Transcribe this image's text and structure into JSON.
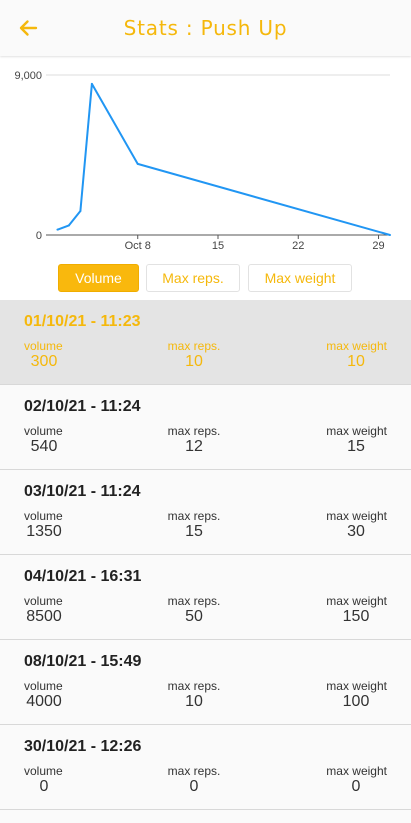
{
  "appbar": {
    "title": "Stats : Push Up",
    "back_icon": "arrow-left-icon",
    "accent_color": "#f5b80c"
  },
  "chart_data": {
    "type": "line",
    "x": [
      "2021-10-01",
      "2021-10-02",
      "2021-10-03",
      "2021-10-04",
      "2021-10-08",
      "2021-10-30"
    ],
    "values": [
      300,
      540,
      1350,
      8500,
      4000,
      0
    ],
    "y_tick_labels": [
      "9,000",
      "0"
    ],
    "y_ticks": [
      9000,
      0
    ],
    "ylim": [
      0,
      9000
    ],
    "x_tick_labels": [
      "Oct 8",
      "15",
      "22",
      "29"
    ],
    "x_ticks": [
      "2021-10-08",
      "2021-10-15",
      "2021-10-22",
      "2021-10-29"
    ],
    "xlim": [
      "2021-09-30",
      "2021-10-30"
    ],
    "line_color": "#2196f3",
    "grid": "horizontal"
  },
  "toggles": [
    {
      "label": "Volume",
      "active": true
    },
    {
      "label": "Max reps.",
      "active": false
    },
    {
      "label": "Max weight",
      "active": false
    }
  ],
  "labels": {
    "volume": "volume",
    "max_reps": "max reps.",
    "max_weight": "max weight"
  },
  "entries": [
    {
      "date": "01/10/21 - 11:23",
      "volume": "300",
      "max_reps": "10",
      "max_weight": "10",
      "selected": true
    },
    {
      "date": "02/10/21 - 11:24",
      "volume": "540",
      "max_reps": "12",
      "max_weight": "15",
      "selected": false
    },
    {
      "date": "03/10/21 - 11:24",
      "volume": "1350",
      "max_reps": "15",
      "max_weight": "30",
      "selected": false
    },
    {
      "date": "04/10/21 - 16:31",
      "volume": "8500",
      "max_reps": "50",
      "max_weight": "150",
      "selected": false
    },
    {
      "date": "08/10/21 - 15:49",
      "volume": "4000",
      "max_reps": "10",
      "max_weight": "100",
      "selected": false
    },
    {
      "date": "30/10/21 - 12:26",
      "volume": "0",
      "max_reps": "0",
      "max_weight": "0",
      "selected": false
    }
  ]
}
